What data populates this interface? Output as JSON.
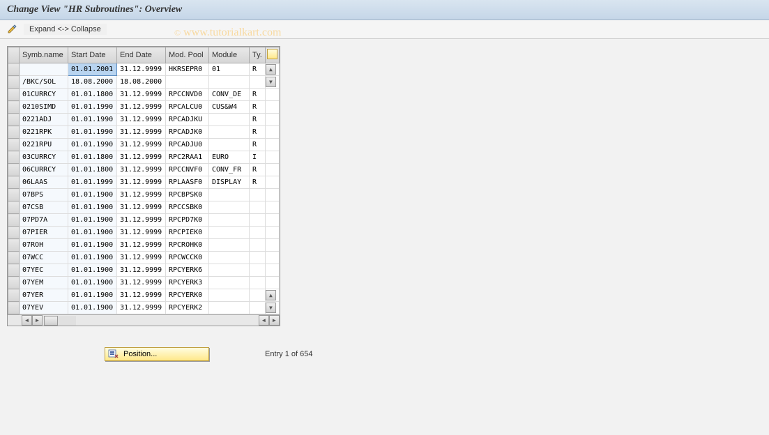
{
  "header": {
    "title": "Change View \"HR Subroutines\": Overview"
  },
  "toolbar": {
    "expand_collapse": "Expand <-> Collapse"
  },
  "watermark": {
    "copy": "©",
    "text": "www.tutorialkart.com"
  },
  "table": {
    "headers": {
      "symb": "Symb.name",
      "start": "Start Date",
      "end": "End Date",
      "pool": "Mod. Pool",
      "module": "Module",
      "ty": "Ty."
    },
    "rows": [
      {
        "symb": "",
        "start": "01.01.2001",
        "end": "31.12.9999",
        "pool": "HKRSEPR0",
        "module": "01",
        "ty": "R",
        "selected": true
      },
      {
        "symb": "/BKC/SOL",
        "start": "18.08.2000",
        "end": "18.08.2000",
        "pool": "",
        "module": "",
        "ty": ""
      },
      {
        "symb": "01CURRCY",
        "start": "01.01.1800",
        "end": "31.12.9999",
        "pool": "RPCCNVD0",
        "module": "CONV_DE",
        "ty": "R"
      },
      {
        "symb": "0210SIMD",
        "start": "01.01.1990",
        "end": "31.12.9999",
        "pool": "RPCALCU0",
        "module": "CUS&W4",
        "ty": "R"
      },
      {
        "symb": "0221ADJ",
        "start": "01.01.1990",
        "end": "31.12.9999",
        "pool": "RPCADJKU",
        "module": "",
        "ty": "R"
      },
      {
        "symb": "0221RPK",
        "start": "01.01.1990",
        "end": "31.12.9999",
        "pool": "RPCADJK0",
        "module": "",
        "ty": "R"
      },
      {
        "symb": "0221RPU",
        "start": "01.01.1990",
        "end": "31.12.9999",
        "pool": "RPCADJU0",
        "module": "",
        "ty": "R"
      },
      {
        "symb": "03CURRCY",
        "start": "01.01.1800",
        "end": "31.12.9999",
        "pool": "RPC2RAA1",
        "module": "EURO",
        "ty": "I"
      },
      {
        "symb": "06CURRCY",
        "start": "01.01.1800",
        "end": "31.12.9999",
        "pool": "RPCCNVF0",
        "module": "CONV_FR",
        "ty": "R"
      },
      {
        "symb": "06LAAS",
        "start": "01.01.1999",
        "end": "31.12.9999",
        "pool": "RPLAASF0",
        "module": "DISPLAY",
        "ty": "R"
      },
      {
        "symb": "07BPS",
        "start": "01.01.1900",
        "end": "31.12.9999",
        "pool": "RPCBPSK0",
        "module": "",
        "ty": ""
      },
      {
        "symb": "07CSB",
        "start": "01.01.1900",
        "end": "31.12.9999",
        "pool": "RPCCSBK0",
        "module": "",
        "ty": ""
      },
      {
        "symb": "07PD7A",
        "start": "01.01.1900",
        "end": "31.12.9999",
        "pool": "RPCPD7K0",
        "module": "",
        "ty": ""
      },
      {
        "symb": "07PIER",
        "start": "01.01.1900",
        "end": "31.12.9999",
        "pool": "RPCPIEK0",
        "module": "",
        "ty": ""
      },
      {
        "symb": "07ROH",
        "start": "01.01.1900",
        "end": "31.12.9999",
        "pool": "RPCROHK0",
        "module": "",
        "ty": ""
      },
      {
        "symb": "07WCC",
        "start": "01.01.1900",
        "end": "31.12.9999",
        "pool": "RPCWCCK0",
        "module": "",
        "ty": ""
      },
      {
        "symb": "07YEC",
        "start": "01.01.1900",
        "end": "31.12.9999",
        "pool": "RPCYERK6",
        "module": "",
        "ty": ""
      },
      {
        "symb": "07YEM",
        "start": "01.01.1900",
        "end": "31.12.9999",
        "pool": "RPCYERK3",
        "module": "",
        "ty": ""
      },
      {
        "symb": "07YER",
        "start": "01.01.1900",
        "end": "31.12.9999",
        "pool": "RPCYERK0",
        "module": "",
        "ty": ""
      },
      {
        "symb": "07YEV",
        "start": "01.01.1900",
        "end": "31.12.9999",
        "pool": "RPCYERK2",
        "module": "",
        "ty": ""
      }
    ]
  },
  "footer": {
    "position_label": "Position...",
    "entry_text": "Entry 1 of 654"
  }
}
